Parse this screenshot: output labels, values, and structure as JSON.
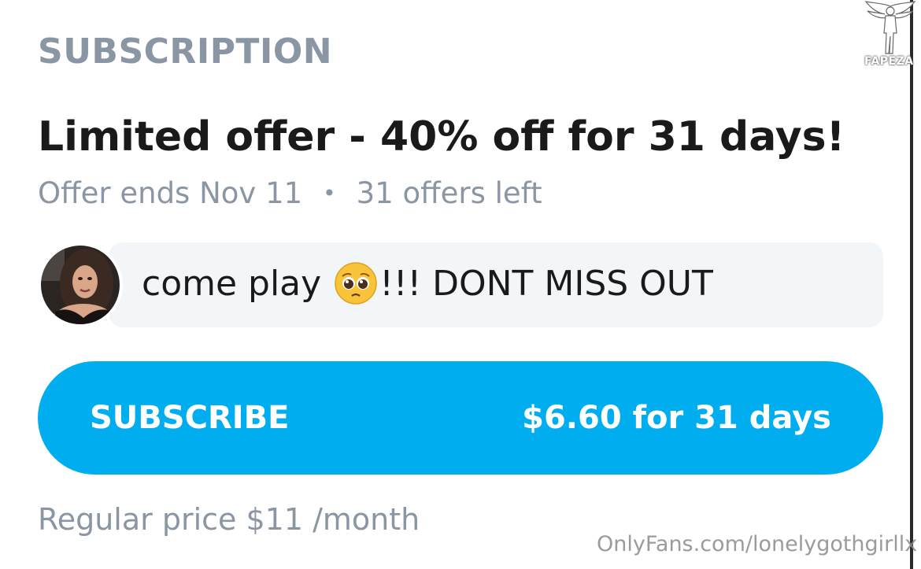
{
  "section": {
    "title": "SUBSCRIPTION"
  },
  "offer": {
    "title": "Limited offer - 40% off for 31 days!",
    "ends": "Offer ends Nov 11",
    "separator": "•",
    "remaining": "31 offers left"
  },
  "message": {
    "text_before": "come play",
    "emoji": "pleading-face-emoji",
    "text_after": "!!! DONT MISS OUT"
  },
  "subscribe": {
    "label": "SUBSCRIBE",
    "price": "$6.60 for 31 days",
    "color": "#00aeef"
  },
  "regular_price": "Regular price $11 /month",
  "watermarks": {
    "url": "OnlyFans.com/lonelygothgirllx",
    "logo_text": "FAPEZA"
  }
}
